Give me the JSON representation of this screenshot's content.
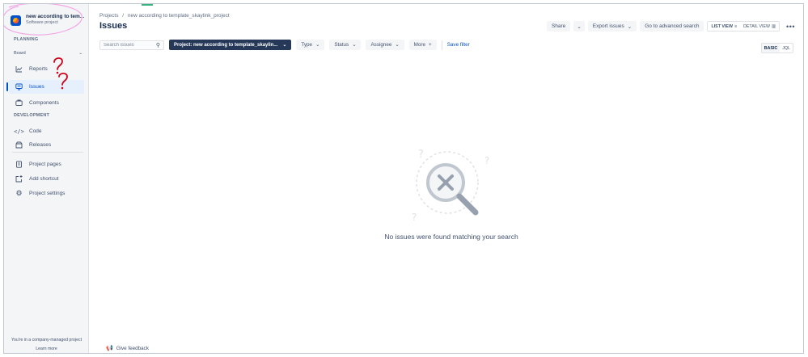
{
  "sidebar": {
    "project_name": "new according to tem...",
    "project_type": "Software project",
    "planning_header": "PLANNING",
    "board_label": "Board",
    "items": [
      {
        "label": "Reports",
        "icon": "chart-icon"
      },
      {
        "label": "Issues",
        "icon": "issues-icon",
        "active": true
      },
      {
        "label": "Components",
        "icon": "components-icon"
      }
    ],
    "development_header": "DEVELOPMENT",
    "dev_items": [
      {
        "label": "Code",
        "icon": "code-icon"
      },
      {
        "label": "Releases",
        "icon": "releases-icon"
      }
    ],
    "other_items": [
      {
        "label": "Project pages",
        "icon": "page-icon"
      },
      {
        "label": "Add shortcut",
        "icon": "add-shortcut-icon"
      },
      {
        "label": "Project settings",
        "icon": "gear-icon"
      }
    ],
    "footer_text": "You're in a company-managed project",
    "learn_more": "Learn more"
  },
  "header": {
    "breadcrumb_root": "Projects",
    "breadcrumb_sep": "/",
    "breadcrumb_project": "new according to template_skaylink_project",
    "title": "Issues",
    "share": "Share",
    "export": "Export issues",
    "advanced": "Go to advanced search",
    "list_view": "LIST VIEW",
    "detail_view": "DETAIL VIEW",
    "more": "•••"
  },
  "filters": {
    "search_placeholder": "Search issues",
    "project_filter": "Project: new according to template_skaylin...",
    "type": "Type",
    "status": "Status",
    "assignee": "Assignee",
    "more": "More",
    "save_filter": "Save filter",
    "basic": "BASIC",
    "jql": "JQL"
  },
  "empty_state": {
    "message": "No issues were found matching your search"
  },
  "feedback": {
    "label": "Give feedback"
  },
  "colors": {
    "accent": "#0052cc",
    "dark_pill": "#253858",
    "annotation_pink": "#f2a6e6",
    "annotation_red": "#d0021b"
  }
}
